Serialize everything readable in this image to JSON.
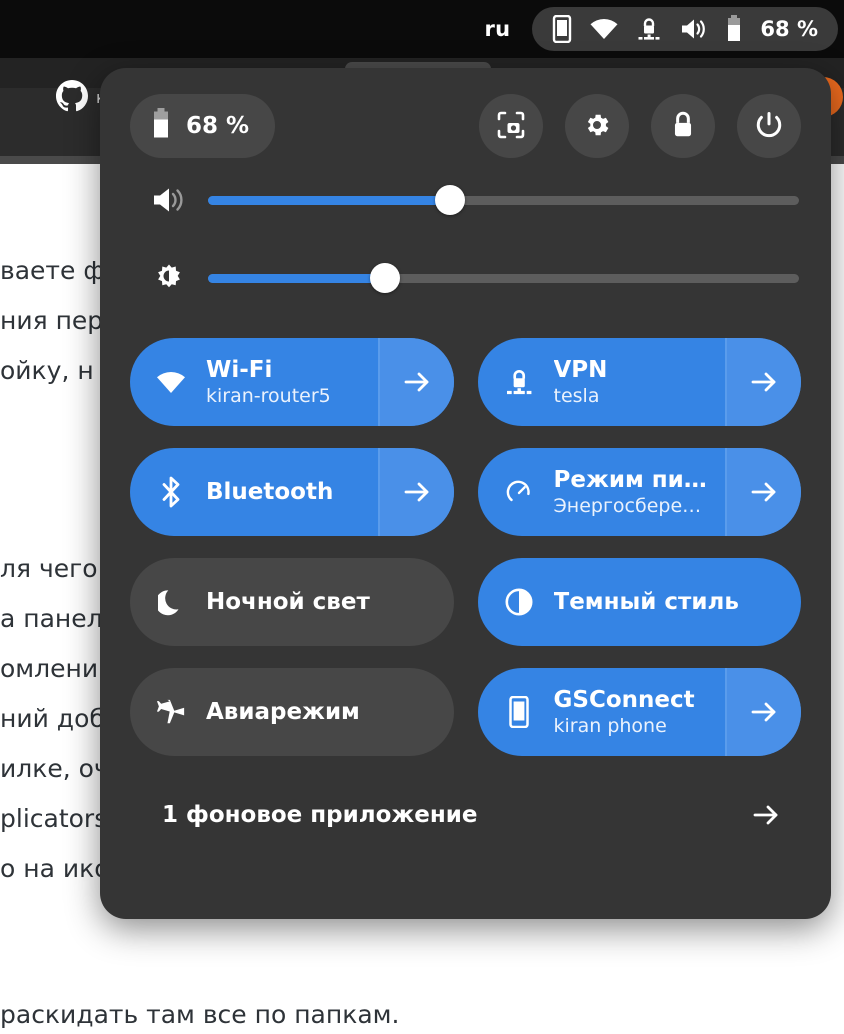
{
  "topbar": {
    "keyboard_layout": "ru",
    "battery_percent": "68 %",
    "icons": [
      "phone-icon",
      "wifi-icon",
      "vpn-lock-icon",
      "volume-icon",
      "battery-icon"
    ]
  },
  "background": {
    "tab_title": "к",
    "page_lines_top": [
      "ваете ф",
      "ния пер",
      "ойку, н"
    ],
    "page_lines_mid": [
      "ля чего",
      "а панел",
      "омлени",
      "ний доб",
      "илке, оч",
      "plicators",
      "о на ико"
    ],
    "page_lines_bottom": [
      "раскидать там все по папкам."
    ]
  },
  "quick_settings": {
    "battery": {
      "label": "68 %",
      "icon": "battery-icon"
    },
    "header_buttons": [
      {
        "name": "screenshot-button",
        "icon": "screenshot-icon"
      },
      {
        "name": "settings-button",
        "icon": "gear-icon"
      },
      {
        "name": "lock-button",
        "icon": "lock-icon"
      },
      {
        "name": "power-button",
        "icon": "power-icon"
      }
    ],
    "sliders": [
      {
        "name": "volume-slider",
        "icon": "volume-icon",
        "value": 41
      },
      {
        "name": "brightness-slider",
        "icon": "brightness-icon",
        "value": 30
      }
    ],
    "tiles": [
      {
        "name": "wifi-tile",
        "title": "Wi-Fi",
        "subtitle": "kiran-router5",
        "icon": "wifi-icon",
        "active": true,
        "has_arrow": true
      },
      {
        "name": "vpn-tile",
        "title": "VPN",
        "subtitle": "tesla",
        "icon": "vpn-lock-icon",
        "active": true,
        "has_arrow": true
      },
      {
        "name": "bluetooth-tile",
        "title": "Bluetooth",
        "subtitle": "",
        "icon": "bluetooth-icon",
        "active": true,
        "has_arrow": true
      },
      {
        "name": "power-mode-tile",
        "title": "Режим пи…",
        "subtitle": "Энергосбере…",
        "icon": "speedometer-icon",
        "active": true,
        "has_arrow": true
      },
      {
        "name": "night-light-tile",
        "title": "Ночной свет",
        "subtitle": "",
        "icon": "moon-icon",
        "active": false,
        "has_arrow": false
      },
      {
        "name": "dark-style-tile",
        "title": "Темный стиль",
        "subtitle": "",
        "icon": "half-circle-icon",
        "active": true,
        "has_arrow": false
      },
      {
        "name": "airplane-mode-tile",
        "title": "Авиарежим",
        "subtitle": "",
        "icon": "airplane-icon",
        "active": false,
        "has_arrow": false
      },
      {
        "name": "gsconnect-tile",
        "title": "GSConnect",
        "subtitle": "kiran phone",
        "icon": "phone-icon",
        "active": true,
        "has_arrow": true
      }
    ],
    "footer": {
      "label": "1 фоновое приложение",
      "arrow_icon": "arrow-right-icon"
    }
  },
  "colors": {
    "accent_blue": "#3584e4",
    "accent_blue_light": "#4a90e8",
    "panel_bg": "#353535",
    "tile_inactive": "#474747",
    "topbar_bg": "#0b0b0b",
    "orange_badge": "#ec6a1e"
  }
}
